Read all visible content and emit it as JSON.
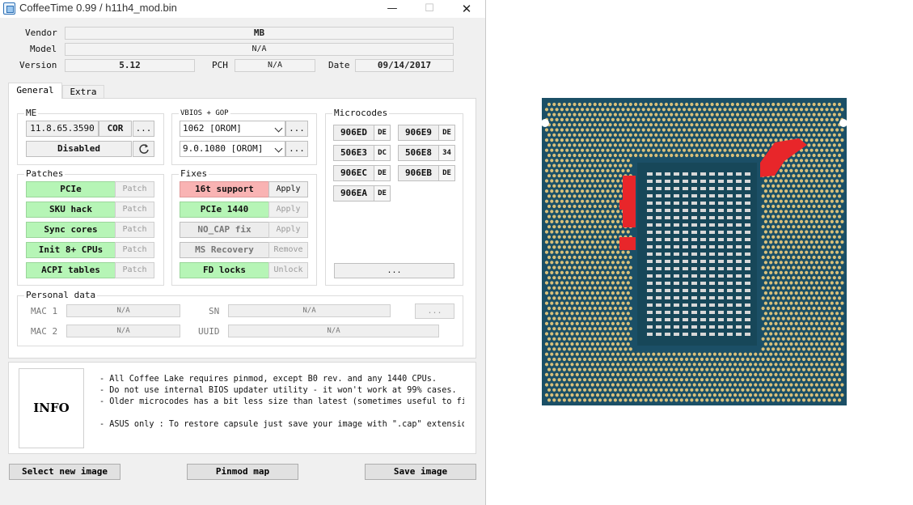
{
  "titlebar": {
    "title": "CoffeeTime 0.99  /  h11h4_mod.bin",
    "min": "—",
    "max": "☐",
    "close": "✕"
  },
  "header": {
    "vendor_label": "Vendor",
    "vendor_value": "MB",
    "model_label": "Model",
    "model_value": "N/A",
    "version_label": "Version",
    "version_value": "5.12",
    "pch_label": "PCH",
    "pch_value": "N/A",
    "date_label": "Date",
    "date_value": "09/14/2017"
  },
  "tabs": [
    {
      "label": "General",
      "active": true
    },
    {
      "label": "Extra",
      "active": false
    }
  ],
  "me": {
    "label": "ME",
    "version": "11.8.65.3590",
    "type": "COR",
    "more": "...",
    "state": "Disabled",
    "refresh_icon": "refresh-icon"
  },
  "vbios": {
    "label": "VBIOS + GOP",
    "vbios_value": "1062 [OROM]",
    "gop_value": "9.0.1080 [OROM]",
    "more": "..."
  },
  "microcodes": {
    "label": "Microcodes",
    "items": [
      {
        "cpuid": "906ED",
        "rev": "DE"
      },
      {
        "cpuid": "906E9",
        "rev": "DE"
      },
      {
        "cpuid": "506E3",
        "rev": "DC"
      },
      {
        "cpuid": "506E8",
        "rev": "34"
      },
      {
        "cpuid": "906EC",
        "rev": "DE"
      },
      {
        "cpuid": "906EB",
        "rev": "DE"
      },
      {
        "cpuid": "906EA",
        "rev": "DE"
      }
    ],
    "more": "..."
  },
  "patches": {
    "label": "Patches",
    "items": [
      {
        "name": "PCIe",
        "action": "Patch"
      },
      {
        "name": "SKU hack",
        "action": "Patch"
      },
      {
        "name": "Sync cores",
        "action": "Patch"
      },
      {
        "name": "Init 8+ CPUs",
        "action": "Patch"
      },
      {
        "name": "ACPI tables",
        "action": "Patch"
      }
    ]
  },
  "fixes": {
    "label": "Fixes",
    "items": [
      {
        "name": "16t support",
        "action": "Apply",
        "status": "needed"
      },
      {
        "name": "PCIe 1440",
        "action": "Apply",
        "status": "done"
      },
      {
        "name": "NO_CAP fix",
        "action": "Apply",
        "status": "na"
      },
      {
        "name": "MS Recovery",
        "action": "Remove",
        "status": "na"
      },
      {
        "name": "FD locks",
        "action": "Unlock",
        "status": "done"
      }
    ]
  },
  "personal": {
    "label": "Personal data",
    "mac1_label": "MAC 1",
    "mac1_value": "N/A",
    "mac2_label": "MAC 2",
    "mac2_value": "N/A",
    "sn_label": "SN",
    "sn_value": "N/A",
    "uuid_label": "UUID",
    "uuid_value": "N/A",
    "more": "..."
  },
  "info": {
    "title": "INFO",
    "lines": [
      "- All Coffee Lake requires pinmod, except B0 rev. and any 1440 CPUs.",
      "- Do not use internal BIOS updater utility - it won't work at 99% cases.",
      "- Older microcodes has a bit less size than latest (sometimes useful to fit i",
      "- ASUS only : To restore capsule just save your image with \".cap\" extension."
    ]
  },
  "buttons": {
    "select": "Select new image",
    "pinmod": "Pinmod map",
    "save": "Save image"
  },
  "cpu_image": {
    "name": "cpu-pin-map-image",
    "highlight_color": "#e8262a",
    "substrate_color": "#1b4f66",
    "pad_color": "#d9c07a"
  }
}
